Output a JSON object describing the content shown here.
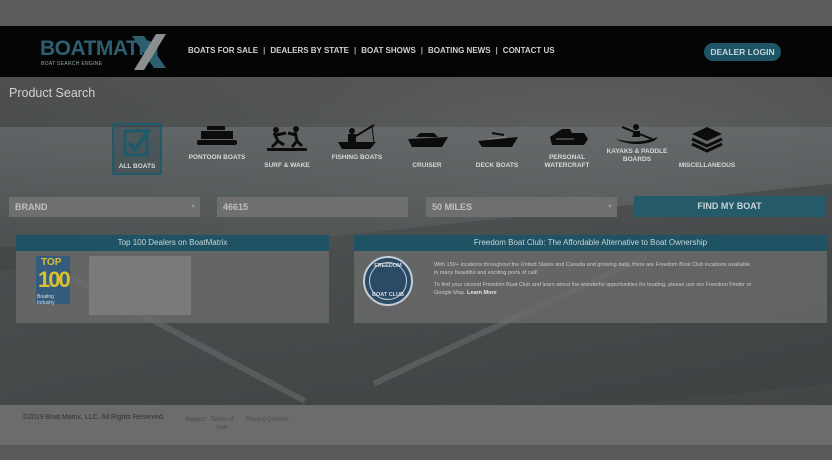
{
  "header": {
    "logo_text": "BOATMATRI",
    "logo_tagline": "BOAT SEARCH ENGINE",
    "nav": [
      "BOATS FOR SALE",
      "DEALERS BY STATE",
      "BOAT SHOWS",
      "BOATING NEWS",
      "CONTACT US"
    ],
    "nav_separator": "|",
    "login_label": "DEALER LOGIN"
  },
  "page_title": "Product Search",
  "categories": [
    {
      "label": "ALL BOATS",
      "icon": "checkmark-icon",
      "active": true
    },
    {
      "label": "PONTOON BOATS",
      "icon": "pontoon-icon"
    },
    {
      "label": "SURF & WAKE",
      "icon": "wakeboard-icon"
    },
    {
      "label": "FISHING BOATS",
      "icon": "fishing-icon"
    },
    {
      "label": "CRUISER",
      "icon": "cruiser-icon"
    },
    {
      "label": "DECK BOATS",
      "icon": "deck-boat-icon"
    },
    {
      "label": "PERSONAL WATERCRAFT",
      "icon": "jetski-icon"
    },
    {
      "label": "KAYAKS & PADDLE BOARDS",
      "icon": "kayak-icon"
    },
    {
      "label": "MISCELLANEOUS",
      "icon": "layers-icon"
    }
  ],
  "filters": {
    "brand": "BRAND",
    "zip": "46615",
    "distance": "50 MILES",
    "find_label": "FIND MY BOAT"
  },
  "dealers_panel": {
    "title": "Top 100 Dealers on BoatMatrix",
    "badge_top": "TOP",
    "badge_num": "100",
    "badge_sub": "Boating Industry"
  },
  "fbc_panel": {
    "title": "Freedom Boat Club: The Affordable Alternative to Boat Ownership",
    "logo_top": "FREEDOM",
    "logo_bottom": "BOAT CLUB",
    "para1": "With 150+ locations throughout the United States and Canada and growing daily, there are Freedom Boat Club locations available in many beautiful and exciting ports of call!",
    "para2": "To find your closest Freedom Boat Club and learn about the wonderful opportunities for boating, please use our Freedom Finder or Google Map.",
    "more": "Learn More"
  },
  "footer": {
    "copyright": "©2019 Boat Matrix, LLC. All Rights Reserved.",
    "links": [
      "Support",
      "Terms of Use",
      "Privacy",
      "Cookies"
    ]
  },
  "colors": {
    "accent": "#1f5263",
    "header_bg": "#050505"
  }
}
